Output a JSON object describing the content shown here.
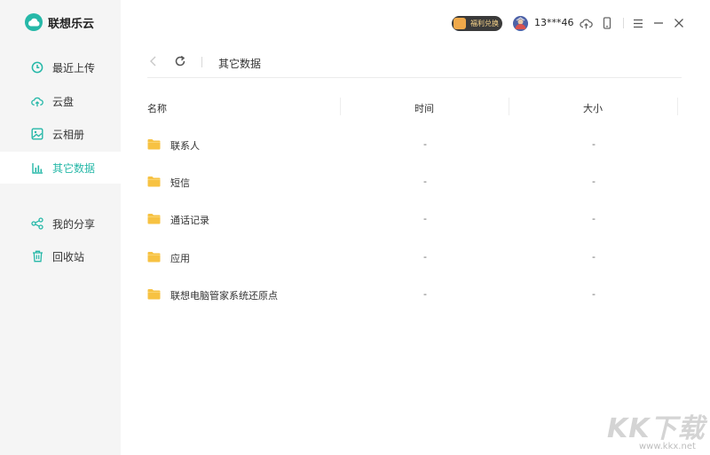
{
  "app": {
    "name": "联想乐云",
    "brand_color": "#26b8a8"
  },
  "sidebar": {
    "items": [
      {
        "label": "最近上传",
        "icon": "clock-icon"
      },
      {
        "label": "云盘",
        "icon": "cloud-upload-icon"
      },
      {
        "label": "云相册",
        "icon": "image-icon"
      },
      {
        "label": "其它数据",
        "icon": "bar-chart-icon",
        "active": true
      },
      {
        "label": "我的分享",
        "icon": "share-icon"
      },
      {
        "label": "回收站",
        "icon": "trash-icon"
      }
    ]
  },
  "header": {
    "badge_label": "福利兑换",
    "username": "13***46",
    "icons": [
      "upload-cloud-icon",
      "phone-icon",
      "menu-icon",
      "minimize-icon",
      "close-icon"
    ]
  },
  "breadcrumb": {
    "current": "其它数据"
  },
  "table": {
    "columns": [
      "名称",
      "时间",
      "大小"
    ],
    "rows": [
      {
        "name": "联系人",
        "time": "-",
        "size": "-"
      },
      {
        "name": "短信",
        "time": "-",
        "size": "-"
      },
      {
        "name": "通话记录",
        "time": "-",
        "size": "-"
      },
      {
        "name": "应用",
        "time": "-",
        "size": "-"
      },
      {
        "name": "联想电脑管家系统还原点",
        "time": "-",
        "size": "-"
      }
    ]
  },
  "watermark": {
    "big": "KK下载",
    "small": "www.kkx.net"
  }
}
